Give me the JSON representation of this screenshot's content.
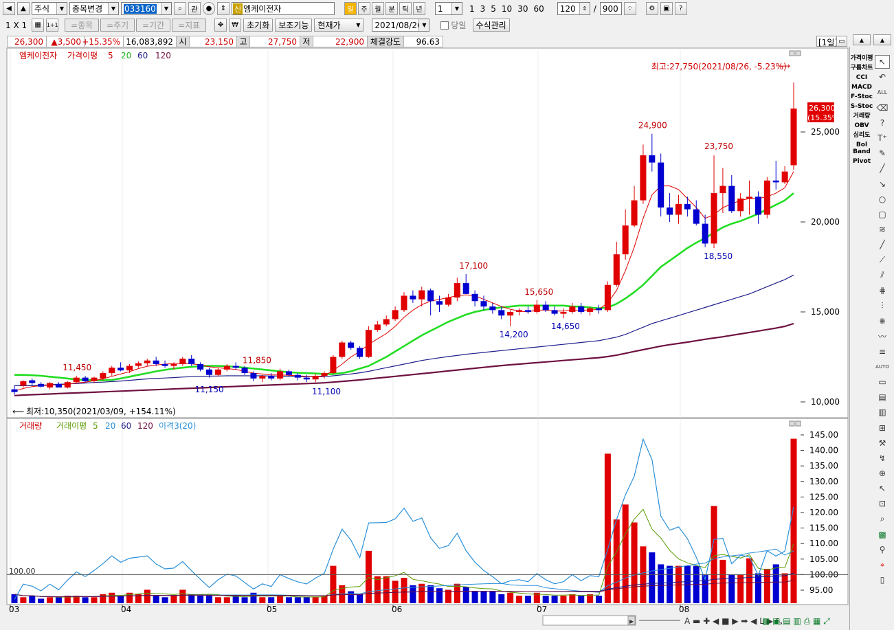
{
  "toolbar1": {
    "market": "주식",
    "change_stock_label": "종목변경",
    "code": "033160",
    "watch_label": "관",
    "new_badge": "신",
    "stock_name": "엠케이전자",
    "periods": [
      "일",
      "주",
      "월",
      "분",
      "틱",
      "년"
    ],
    "period_count": "1",
    "minute_buttons": [
      "1",
      "3",
      "5",
      "10",
      "30",
      "60"
    ],
    "view_count": "120",
    "total_count": "900",
    "slash": "/"
  },
  "toolbar2": {
    "layout_label": "1 X 1",
    "one_label": "1+1",
    "disabled_buttons": [
      "=종목",
      "=주기",
      "=기간",
      "=지표"
    ],
    "reset_label": "초기화",
    "aux_label": "보조기능",
    "price_type": "현재가",
    "date": "2021/08/26",
    "today_label": "당일",
    "formula_label": "수식관리",
    "period_tag": "[1일]"
  },
  "quote": {
    "price": "26,300",
    "change": "▲3,500",
    "change_pct": "+15.35%",
    "volume": "16,083,892",
    "open_label": "시",
    "open": "23,150",
    "high_label": "고",
    "high": "27,750",
    "low_label": "저",
    "low": "22,900",
    "strength_label": "체결강도",
    "strength": "96.63"
  },
  "price_pane": {
    "legend_name": "엠케이전자",
    "legend_ma_label": "가격이평",
    "legend_ma": [
      "5",
      "20",
      "60",
      "120"
    ],
    "max_note": "최고:27,750(2021/08/26, -5.23%)",
    "min_note": "최저:10,350(2021/03/09, +154.11%)",
    "last_price": "26,300",
    "last_pct": "(15.35%)",
    "y_ticks": [
      "25,000",
      "20,000",
      "15,000",
      "10,000"
    ],
    "annotations": {
      "a1": "11,450",
      "a2": "11,150",
      "a3": "11,850",
      "a4": "11,100",
      "a5": "17,100",
      "a6": "14,200",
      "a7": "15,650",
      "a8": "14,650",
      "a9": "24,900",
      "a10": "23,750",
      "a11": "18,550"
    }
  },
  "volume_pane": {
    "legend_name": "거래량",
    "legend_ma_label": "거래이평",
    "legend_ma": [
      "5",
      "20",
      "60",
      "120"
    ],
    "legend_disparity": "이격3(20)",
    "baseline": "100.00",
    "y_ticks": [
      "145.00",
      "140.00",
      "135.00",
      "130.00",
      "125.00",
      "120.00",
      "115.00",
      "110.00",
      "105.00",
      "100.00",
      "95.00"
    ]
  },
  "x_axis": [
    "03",
    "04",
    "05",
    "06",
    "07",
    "08"
  ],
  "right_indicators": [
    "가격이평",
    "구름차트",
    "CCI",
    "MACD",
    "F-Stoc",
    "S-Stoc",
    "거래량",
    "OBV",
    "심리도",
    "Bol Band",
    "Pivot"
  ],
  "colors": {
    "up": "#e00000",
    "down": "#0000d0",
    "ma5": "#e00000",
    "ma20": "#22dd22",
    "ma60": "#1e1e8c",
    "ma120": "#6e1040",
    "disparity": "#2a8fd8"
  },
  "chart_data": {
    "type": "candlestick",
    "candles": [
      [
        10.7,
        10.9,
        10.4,
        10.55
      ],
      [
        10.9,
        11.2,
        10.8,
        11.15
      ],
      [
        11.2,
        11.3,
        10.95,
        11.05
      ],
      [
        11.0,
        11.1,
        10.8,
        10.85
      ],
      [
        10.8,
        11.1,
        10.7,
        11.05
      ],
      [
        11.0,
        11.1,
        10.8,
        10.8
      ],
      [
        10.8,
        11.15,
        10.75,
        11.1
      ],
      [
        11.1,
        11.45,
        11.0,
        11.35
      ],
      [
        11.35,
        11.45,
        11.1,
        11.15
      ],
      [
        11.15,
        11.4,
        11.05,
        11.35
      ],
      [
        11.3,
        11.7,
        11.2,
        11.6
      ],
      [
        11.6,
        12.0,
        11.45,
        11.9
      ],
      [
        11.9,
        12.2,
        11.7,
        11.75
      ],
      [
        11.75,
        12.1,
        11.6,
        12.0
      ],
      [
        12.0,
        12.25,
        11.9,
        12.15
      ],
      [
        12.15,
        12.4,
        12.0,
        12.3
      ],
      [
        12.3,
        12.5,
        12.0,
        12.1
      ],
      [
        12.1,
        12.3,
        11.9,
        12.0
      ],
      [
        12.0,
        12.2,
        11.8,
        12.1
      ],
      [
        12.1,
        12.5,
        12.0,
        12.4
      ],
      [
        12.4,
        12.6,
        12.0,
        12.1
      ],
      [
        12.1,
        12.2,
        11.7,
        11.8
      ],
      [
        11.8,
        11.9,
        11.35,
        11.5
      ],
      [
        11.5,
        11.9,
        11.4,
        11.8
      ],
      [
        11.8,
        12.1,
        11.7,
        12.0
      ],
      [
        12.0,
        12.2,
        11.8,
        11.9
      ],
      [
        11.9,
        12.0,
        11.5,
        11.6
      ],
      [
        11.6,
        11.7,
        11.15,
        11.3
      ],
      [
        11.3,
        11.5,
        11.1,
        11.45
      ],
      [
        11.45,
        11.6,
        11.2,
        11.3
      ],
      [
        11.3,
        11.85,
        11.2,
        11.7
      ],
      [
        11.7,
        11.8,
        11.4,
        11.5
      ],
      [
        11.5,
        11.6,
        11.2,
        11.35
      ],
      [
        11.35,
        11.5,
        11.1,
        11.25
      ],
      [
        11.25,
        11.55,
        11.1,
        11.45
      ],
      [
        11.45,
        11.7,
        11.3,
        11.6
      ],
      [
        11.6,
        12.6,
        11.55,
        12.5
      ],
      [
        12.5,
        13.4,
        12.4,
        13.3
      ],
      [
        13.3,
        13.4,
        12.9,
        13.0
      ],
      [
        13.0,
        13.1,
        12.4,
        12.5
      ],
      [
        12.5,
        14.2,
        12.45,
        14.0
      ],
      [
        14.0,
        14.5,
        13.9,
        14.3
      ],
      [
        14.3,
        14.8,
        14.2,
        14.6
      ],
      [
        14.6,
        15.3,
        14.5,
        15.1
      ],
      [
        15.1,
        16.1,
        15.0,
        15.9
      ],
      [
        15.9,
        16.2,
        15.5,
        15.7
      ],
      [
        15.7,
        16.4,
        15.3,
        16.2
      ],
      [
        16.2,
        16.3,
        14.8,
        15.6
      ],
      [
        15.6,
        15.9,
        15.0,
        15.4
      ],
      [
        15.4,
        16.0,
        15.3,
        15.8
      ],
      [
        15.8,
        16.9,
        15.6,
        16.6
      ],
      [
        16.6,
        17.1,
        16.0,
        16.0
      ],
      [
        16.0,
        16.2,
        15.3,
        15.6
      ],
      [
        15.6,
        15.9,
        15.1,
        15.3
      ],
      [
        15.3,
        15.5,
        14.9,
        15.1
      ],
      [
        15.1,
        15.3,
        14.6,
        14.8
      ],
      [
        14.8,
        15.1,
        14.2,
        15.0
      ],
      [
        15.0,
        15.2,
        14.8,
        15.1
      ],
      [
        15.1,
        15.3,
        14.9,
        15.0
      ],
      [
        15.0,
        15.65,
        14.9,
        15.4
      ],
      [
        15.4,
        15.6,
        15.0,
        15.1
      ],
      [
        15.1,
        15.3,
        14.8,
        14.9
      ],
      [
        14.9,
        15.2,
        14.65,
        15.0
      ],
      [
        15.0,
        15.5,
        14.9,
        15.3
      ],
      [
        15.3,
        15.5,
        14.9,
        15.0
      ],
      [
        15.0,
        15.3,
        14.8,
        15.2
      ],
      [
        15.2,
        15.4,
        14.9,
        15.1
      ],
      [
        15.1,
        16.7,
        15.0,
        16.5
      ],
      [
        16.5,
        18.9,
        16.4,
        18.2
      ],
      [
        18.2,
        20.7,
        17.9,
        19.8
      ],
      [
        19.8,
        22.0,
        19.7,
        21.2
      ],
      [
        21.2,
        24.3,
        21.0,
        23.7
      ],
      [
        23.7,
        24.9,
        22.8,
        23.3
      ],
      [
        23.3,
        23.8,
        20.3,
        20.8
      ],
      [
        20.8,
        21.6,
        20.0,
        20.4
      ],
      [
        20.4,
        21.5,
        19.9,
        21.0
      ],
      [
        21.0,
        21.4,
        20.3,
        20.7
      ],
      [
        20.7,
        21.2,
        19.8,
        19.9
      ],
      [
        19.9,
        20.4,
        18.6,
        18.8
      ],
      [
        18.8,
        23.7,
        18.55,
        21.6
      ],
      [
        21.6,
        23.0,
        20.5,
        22.0
      ],
      [
        22.0,
        22.6,
        20.5,
        20.6
      ],
      [
        20.6,
        21.6,
        20.3,
        21.3
      ],
      [
        21.3,
        22.3,
        20.4,
        21.4
      ],
      [
        21.4,
        21.7,
        19.9,
        20.4
      ],
      [
        20.4,
        22.5,
        20.2,
        22.3
      ],
      [
        22.3,
        23.4,
        21.8,
        22.2
      ],
      [
        22.2,
        23.1,
        22.1,
        22.8
      ],
      [
        23.15,
        27.75,
        22.9,
        26.3
      ]
    ],
    "ma5": [
      10.6,
      10.75,
      10.85,
      10.9,
      10.93,
      10.95,
      10.98,
      11.05,
      11.1,
      11.18,
      11.28,
      11.42,
      11.55,
      11.68,
      11.85,
      11.98,
      12.05,
      12.1,
      12.13,
      12.15,
      12.12,
      12.05,
      11.95,
      11.9,
      11.85,
      11.8,
      11.7,
      11.6,
      11.55,
      11.5,
      11.5,
      11.48,
      11.45,
      11.42,
      11.4,
      11.45,
      11.75,
      12.1,
      12.5,
      12.8,
      13.2,
      13.5,
      13.8,
      14.2,
      14.7,
      15.1,
      15.4,
      15.6,
      15.7,
      15.8,
      15.9,
      15.95,
      15.9,
      15.7,
      15.5,
      15.3,
      15.15,
      15.05,
      15.0,
      15.1,
      15.1,
      15.05,
      15.05,
      15.1,
      15.1,
      15.1,
      15.15,
      15.5,
      16.2,
      17.3,
      18.6,
      20.2,
      21.5,
      22.0,
      22.0,
      21.8,
      21.3,
      20.8,
      20.2,
      20.4,
      20.8,
      21.0,
      21.2,
      21.3,
      21.3,
      21.4,
      21.6,
      21.9,
      22.8
    ],
    "ma20": [
      11.5,
      11.5,
      11.48,
      11.45,
      11.4,
      11.35,
      11.3,
      11.25,
      11.22,
      11.2,
      11.2,
      11.22,
      11.3,
      11.4,
      11.5,
      11.6,
      11.7,
      11.78,
      11.85,
      11.9,
      11.95,
      11.98,
      12.0,
      12.0,
      11.98,
      11.95,
      11.9,
      11.85,
      11.8,
      11.75,
      11.7,
      11.65,
      11.62,
      11.6,
      11.58,
      11.55,
      11.55,
      11.6,
      11.7,
      11.85,
      12.0,
      12.25,
      12.5,
      12.8,
      13.1,
      13.4,
      13.7,
      13.95,
      14.2,
      14.45,
      14.65,
      14.85,
      15.0,
      15.1,
      15.2,
      15.25,
      15.3,
      15.35,
      15.35,
      15.35,
      15.35,
      15.35,
      15.35,
      15.3,
      15.3,
      15.25,
      15.2,
      15.25,
      15.45,
      15.75,
      16.1,
      16.5,
      17.0,
      17.5,
      17.85,
      18.2,
      18.55,
      18.85,
      19.1,
      19.4,
      19.7,
      19.9,
      20.05,
      20.25,
      20.45,
      20.7,
      20.95,
      21.2,
      21.6
    ],
    "ma60": [
      10.9,
      10.9,
      10.9,
      10.92,
      10.95,
      10.98,
      11.0,
      11.02,
      11.05,
      11.08,
      11.1,
      11.13,
      11.16,
      11.2,
      11.24,
      11.28,
      11.3,
      11.33,
      11.35,
      11.38,
      11.4,
      11.42,
      11.43,
      11.44,
      11.45,
      11.45,
      11.45,
      11.45,
      11.45,
      11.44,
      11.43,
      11.42,
      11.41,
      11.4,
      11.4,
      11.4,
      11.45,
      11.5,
      11.55,
      11.62,
      11.7,
      11.8,
      11.9,
      12.0,
      12.1,
      12.2,
      12.3,
      12.38,
      12.45,
      12.52,
      12.58,
      12.65,
      12.7,
      12.75,
      12.8,
      12.85,
      12.9,
      12.95,
      13.0,
      13.05,
      13.1,
      13.15,
      13.2,
      13.25,
      13.3,
      13.35,
      13.4,
      13.5,
      13.6,
      13.75,
      13.95,
      14.15,
      14.35,
      14.5,
      14.65,
      14.8,
      14.95,
      15.1,
      15.25,
      15.4,
      15.55,
      15.7,
      15.85,
      16.0,
      16.2,
      16.4,
      16.6,
      16.8,
      17.05
    ],
    "ma120": [
      10.35,
      10.38,
      10.4,
      10.42,
      10.44,
      10.46,
      10.48,
      10.5,
      10.52,
      10.54,
      10.56,
      10.58,
      10.6,
      10.62,
      10.64,
      10.66,
      10.68,
      10.7,
      10.72,
      10.74,
      10.76,
      10.78,
      10.8,
      10.82,
      10.84,
      10.86,
      10.88,
      10.9,
      10.92,
      10.94,
      10.96,
      10.98,
      11.0,
      11.02,
      11.04,
      11.06,
      11.1,
      11.14,
      11.18,
      11.22,
      11.27,
      11.32,
      11.37,
      11.42,
      11.47,
      11.52,
      11.57,
      11.62,
      11.67,
      11.72,
      11.77,
      11.82,
      11.87,
      11.92,
      11.97,
      12.02,
      12.06,
      12.1,
      12.14,
      12.18,
      12.22,
      12.26,
      12.3,
      12.34,
      12.38,
      12.42,
      12.46,
      12.52,
      12.6,
      12.7,
      12.8,
      12.9,
      13.0,
      13.1,
      13.18,
      13.25,
      13.32,
      13.4,
      13.48,
      13.55,
      13.62,
      13.7,
      13.78,
      13.86,
      13.94,
      14.02,
      14.1,
      14.2,
      14.35
    ],
    "volume_scale": "relative height 0-1",
    "volume": [
      0.06,
      0.04,
      0.05,
      0.03,
      0.04,
      0.04,
      0.05,
      0.05,
      0.04,
      0.04,
      0.06,
      0.07,
      0.05,
      0.07,
      0.06,
      0.09,
      0.05,
      0.04,
      0.05,
      0.09,
      0.06,
      0.05,
      0.05,
      0.04,
      0.04,
      0.05,
      0.04,
      0.07,
      0.04,
      0.04,
      0.05,
      0.04,
      0.04,
      0.04,
      0.04,
      0.05,
      0.25,
      0.12,
      0.08,
      0.06,
      0.35,
      0.18,
      0.18,
      0.15,
      0.17,
      0.12,
      0.13,
      0.12,
      0.1,
      0.09,
      0.13,
      0.11,
      0.08,
      0.08,
      0.08,
      0.06,
      0.07,
      0.05,
      0.05,
      0.07,
      0.05,
      0.05,
      0.05,
      0.06,
      0.05,
      0.06,
      0.05,
      1.0,
      0.56,
      0.66,
      0.54,
      0.38,
      0.34,
      0.26,
      0.25,
      0.25,
      0.25,
      0.25,
      0.19,
      0.65,
      0.29,
      0.19,
      0.19,
      0.3,
      0.2,
      0.23,
      0.26,
      0.2,
      1.1
    ]
  }
}
